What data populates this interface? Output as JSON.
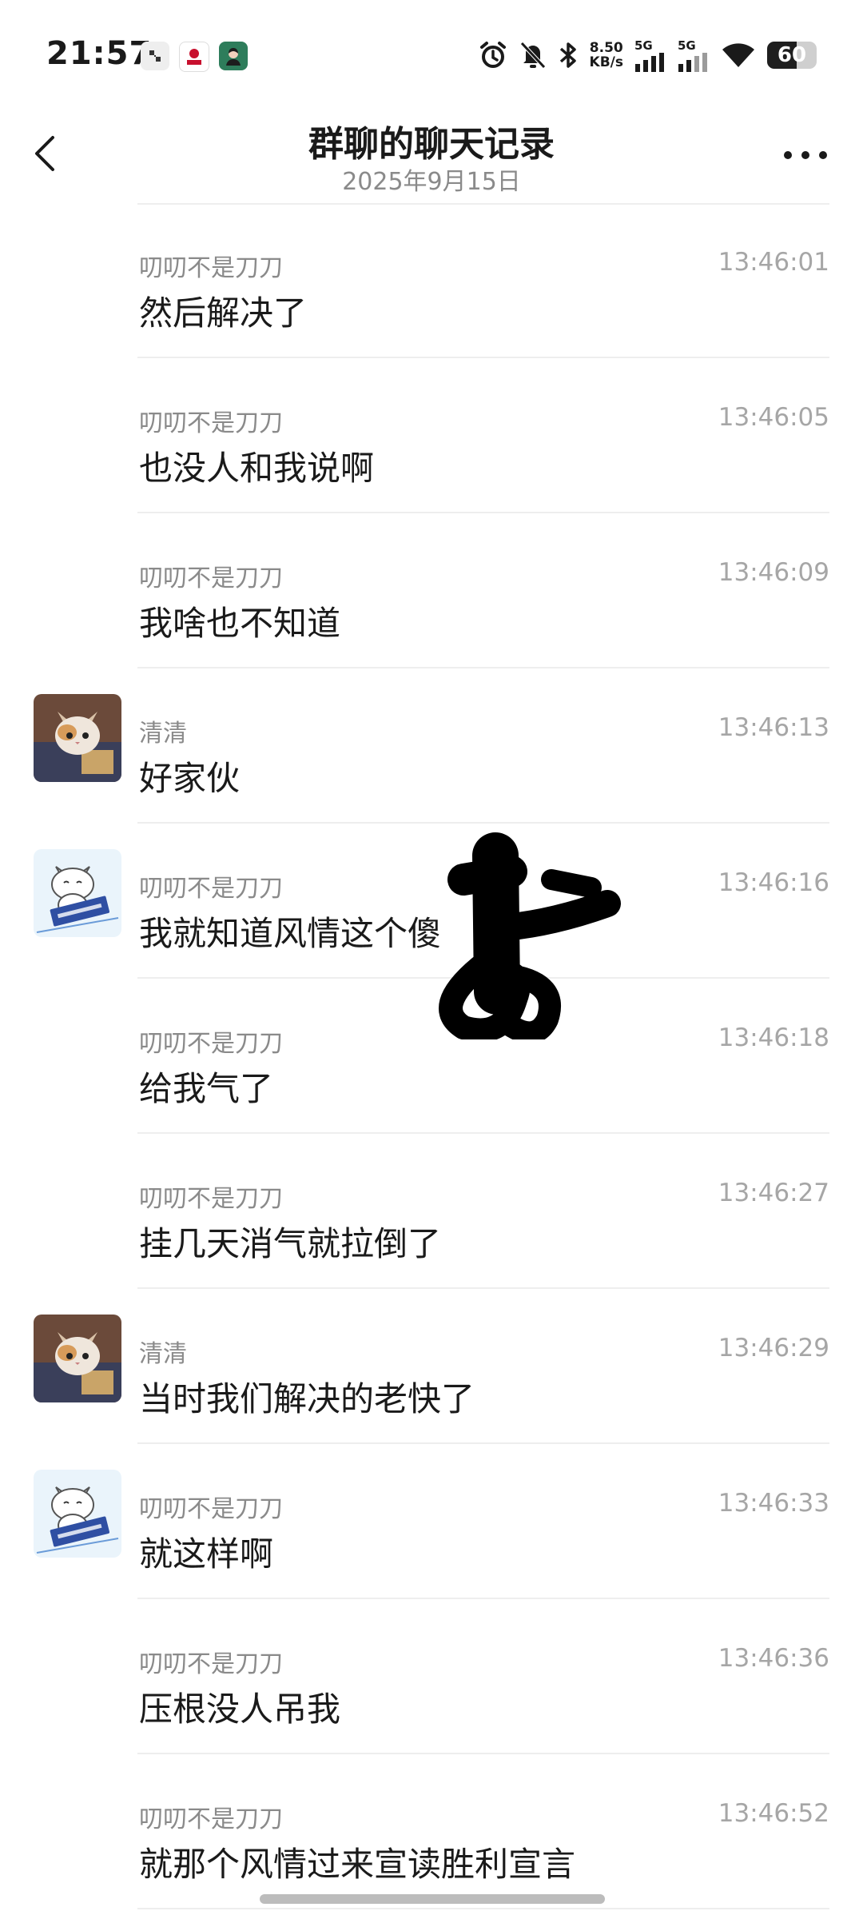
{
  "status_bar": {
    "time": "21:57",
    "net_speed_value": "8.50",
    "net_speed_unit": "KB/s",
    "sig1_label": "5G",
    "sig2_label": "5G",
    "battery": "60",
    "battery_level": 0.6
  },
  "header": {
    "title": "群聊的聊天记录",
    "subtitle": "2025年9月15日"
  },
  "messages": [
    {
      "sender": "叨叨不是刀刀",
      "time": "13:46:01",
      "text": "然后解决了",
      "avatar": "none"
    },
    {
      "sender": "叨叨不是刀刀",
      "time": "13:46:05",
      "text": "也没人和我说啊",
      "avatar": "none"
    },
    {
      "sender": "叨叨不是刀刀",
      "time": "13:46:09",
      "text": "我啥也不知道",
      "avatar": "none"
    },
    {
      "sender": "清清",
      "time": "13:46:13",
      "text": "好家伙",
      "avatar": "kitten-photo"
    },
    {
      "sender": "叨叨不是刀刀",
      "time": "13:46:16",
      "text": "我就知道风情这个傻",
      "avatar": "cartoon-cat"
    },
    {
      "sender": "叨叨不是刀刀",
      "time": "13:46:18",
      "text": "给我气了",
      "avatar": "none"
    },
    {
      "sender": "叨叨不是刀刀",
      "time": "13:46:27",
      "text": "挂几天消气就拉倒了",
      "avatar": "none"
    },
    {
      "sender": "清清",
      "time": "13:46:29",
      "text": "当时我们解决的老快了",
      "avatar": "kitten-photo"
    },
    {
      "sender": "叨叨不是刀刀",
      "time": "13:46:33",
      "text": "就这样啊",
      "avatar": "cartoon-cat"
    },
    {
      "sender": "叨叨不是刀刀",
      "time": "13:46:36",
      "text": "压根没人吊我",
      "avatar": "none"
    },
    {
      "sender": "叨叨不是刀刀",
      "time": "13:46:52",
      "text": "就那个风情过来宣读胜利宣言",
      "avatar": "none"
    }
  ],
  "icons": {
    "back": "chevron-left-icon",
    "more": "more-dots-icon",
    "alarm": "alarm-icon",
    "mute": "bell-off-icon",
    "bluetooth": "bluetooth-icon",
    "wifi": "wifi-icon"
  },
  "colors": {
    "background": "#ffffff",
    "text_primary": "#1a1a1a",
    "text_secondary": "#8a8a8a",
    "time": "#a6a6a6",
    "divider": "#eeeeee"
  }
}
